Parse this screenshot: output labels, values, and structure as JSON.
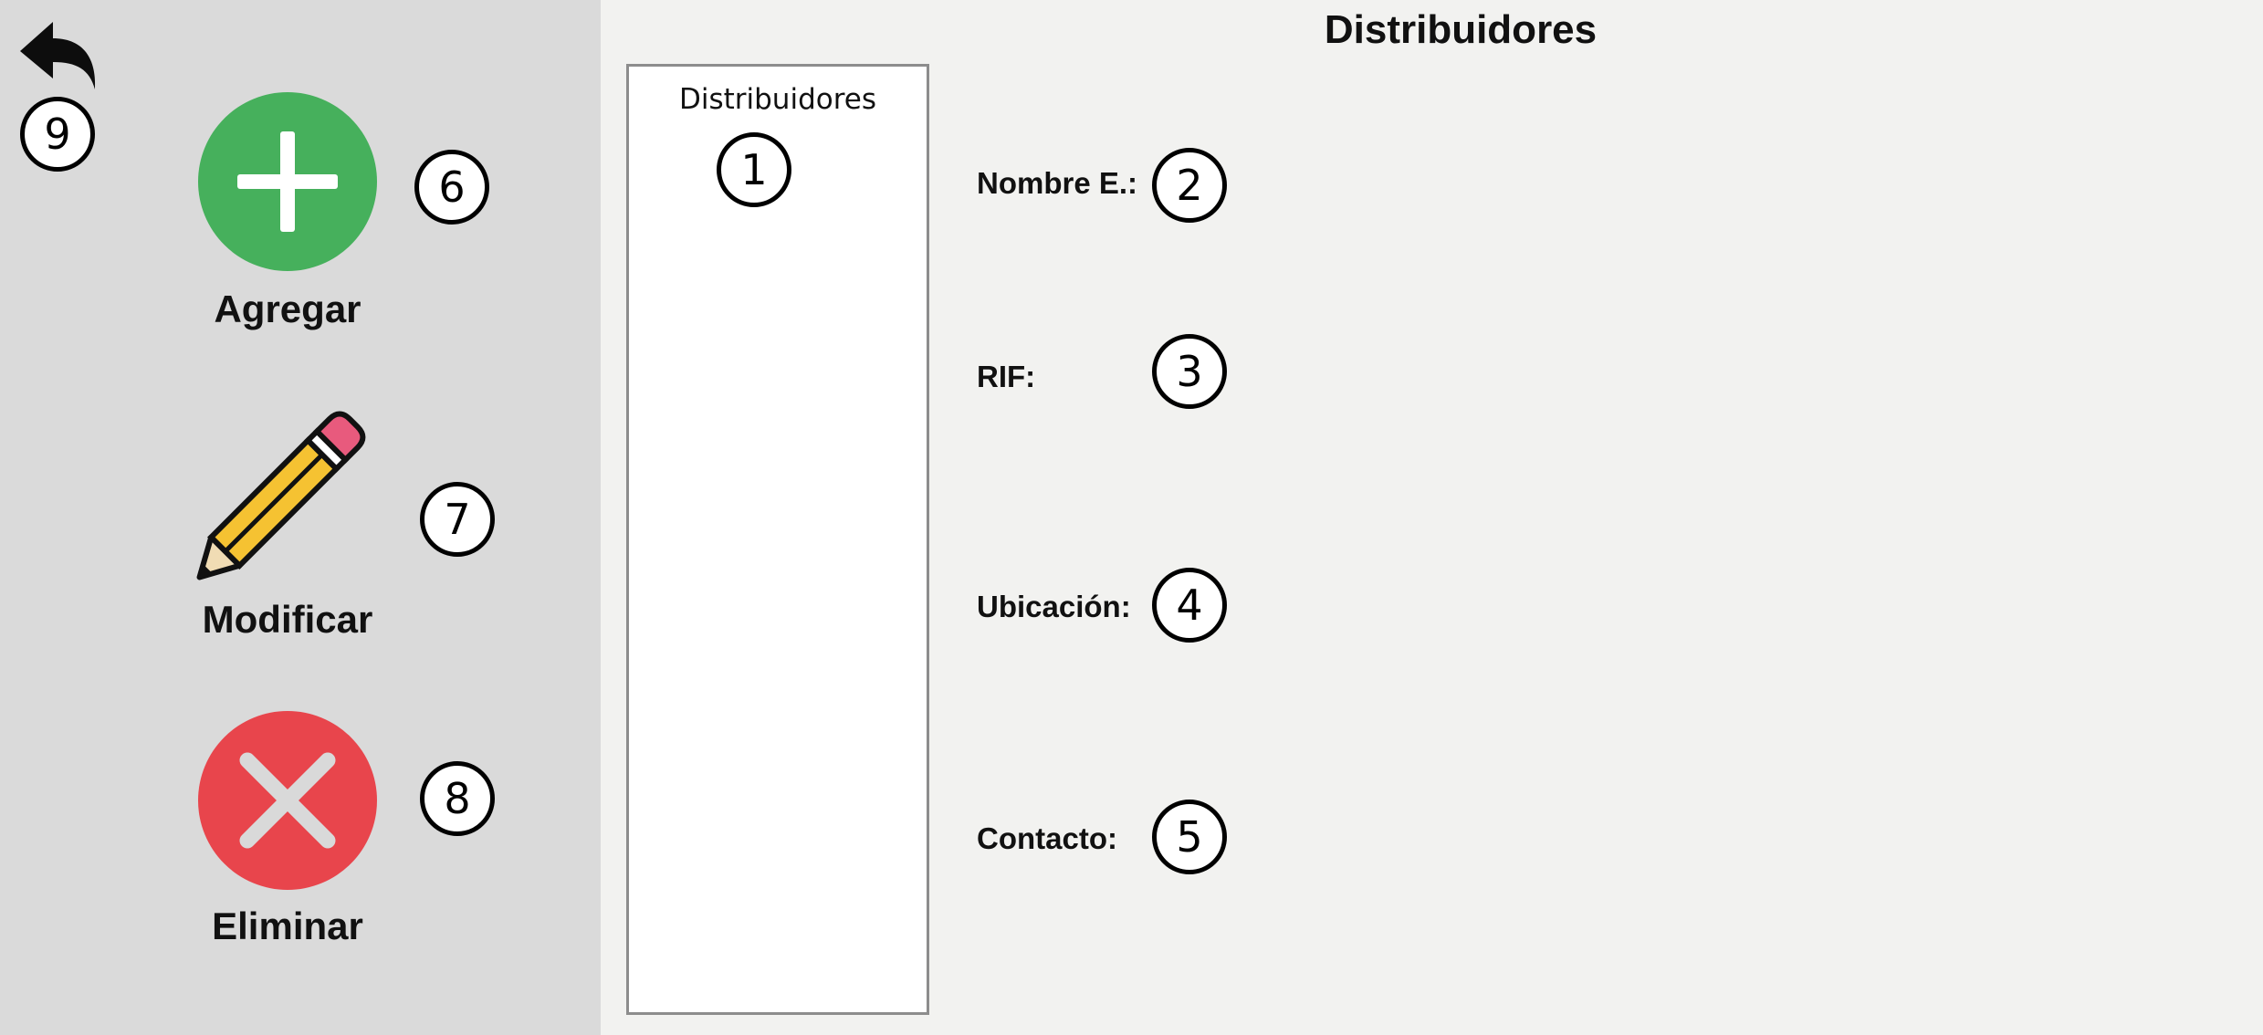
{
  "window": {
    "title": "Distribuidores"
  },
  "sidebar": {
    "back_marker": "9",
    "actions": [
      {
        "label": "Agregar",
        "marker": "6",
        "icon": "add-icon",
        "color": "#46b05c"
      },
      {
        "label": "Modificar",
        "marker": "7",
        "icon": "pencil-icon",
        "color": "#f5c232"
      },
      {
        "label": "Eliminar",
        "marker": "8",
        "icon": "delete-icon",
        "color": "#e8454c"
      }
    ]
  },
  "list": {
    "header": "Distribuidores",
    "marker": "1"
  },
  "fields": [
    {
      "label": "Nombre E.:",
      "marker": "2"
    },
    {
      "label": "RIF:",
      "marker": "3"
    },
    {
      "label": "Ubicación:",
      "marker": "4"
    },
    {
      "label": "Contacto:",
      "marker": "5"
    }
  ]
}
